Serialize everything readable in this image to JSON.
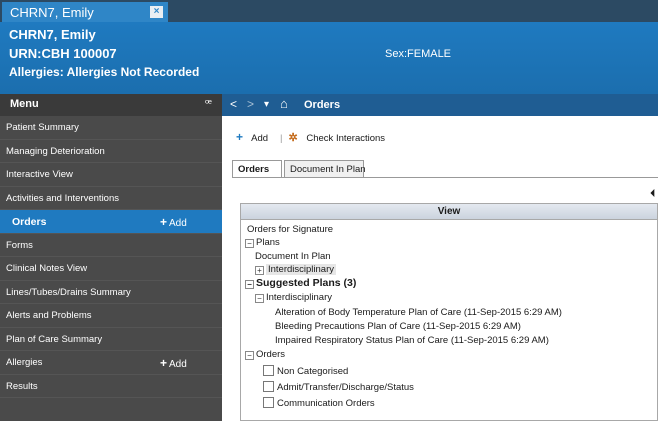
{
  "patient_tab": {
    "label": "CHRN7, Emily",
    "close": "×"
  },
  "banner": {
    "name": "CHRN7, Emily",
    "urn": "URN:CBH 100007",
    "allergies": "Allergies: Allergies Not Recorded",
    "sex": "Sex:FEMALE"
  },
  "menu": {
    "title": "Menu",
    "pin": "ꟹ",
    "items": [
      {
        "label": "Patient Summary"
      },
      {
        "label": "Managing Deterioration"
      },
      {
        "label": "Interactive View"
      },
      {
        "label": "Activities and Interventions"
      },
      {
        "label": "Orders",
        "add": "Add"
      },
      {
        "label": "Forms"
      },
      {
        "label": "Clinical Notes View"
      },
      {
        "label": "Lines/Tubes/Drains Summary"
      },
      {
        "label": "Alerts and Problems"
      },
      {
        "label": "Plan of Care Summary"
      },
      {
        "label": "Allergies",
        "add": "Add"
      },
      {
        "label": "Results"
      }
    ]
  },
  "navbar": {
    "back": "<",
    "forward": ">",
    "dropdown": "▾",
    "home": "⌂",
    "title": "Orders"
  },
  "toolbar": {
    "add": "Add",
    "check": "Check Interactions"
  },
  "view_tabs": {
    "orders": "Orders",
    "document_in_plan": "Document In Plan"
  },
  "collapse_marker": "⏴",
  "tree": {
    "header": "View",
    "rows": [
      "Orders for Signature",
      "Plans",
      "Document In Plan",
      "Interdisciplinary",
      "Suggested Plans (3)",
      "Interdisciplinary",
      "Alteration of Body Temperature Plan of Care (11-Sep-2015 6:29 AM)",
      "Bleeding Precautions Plan of Care (11-Sep-2015 6:29 AM)",
      "Impaired Respiratory Status Plan of Care (11-Sep-2015 6:29 AM)",
      "Orders",
      "Non Categorised",
      "Admit/Transfer/Discharge/Status",
      "Communication Orders"
    ]
  }
}
